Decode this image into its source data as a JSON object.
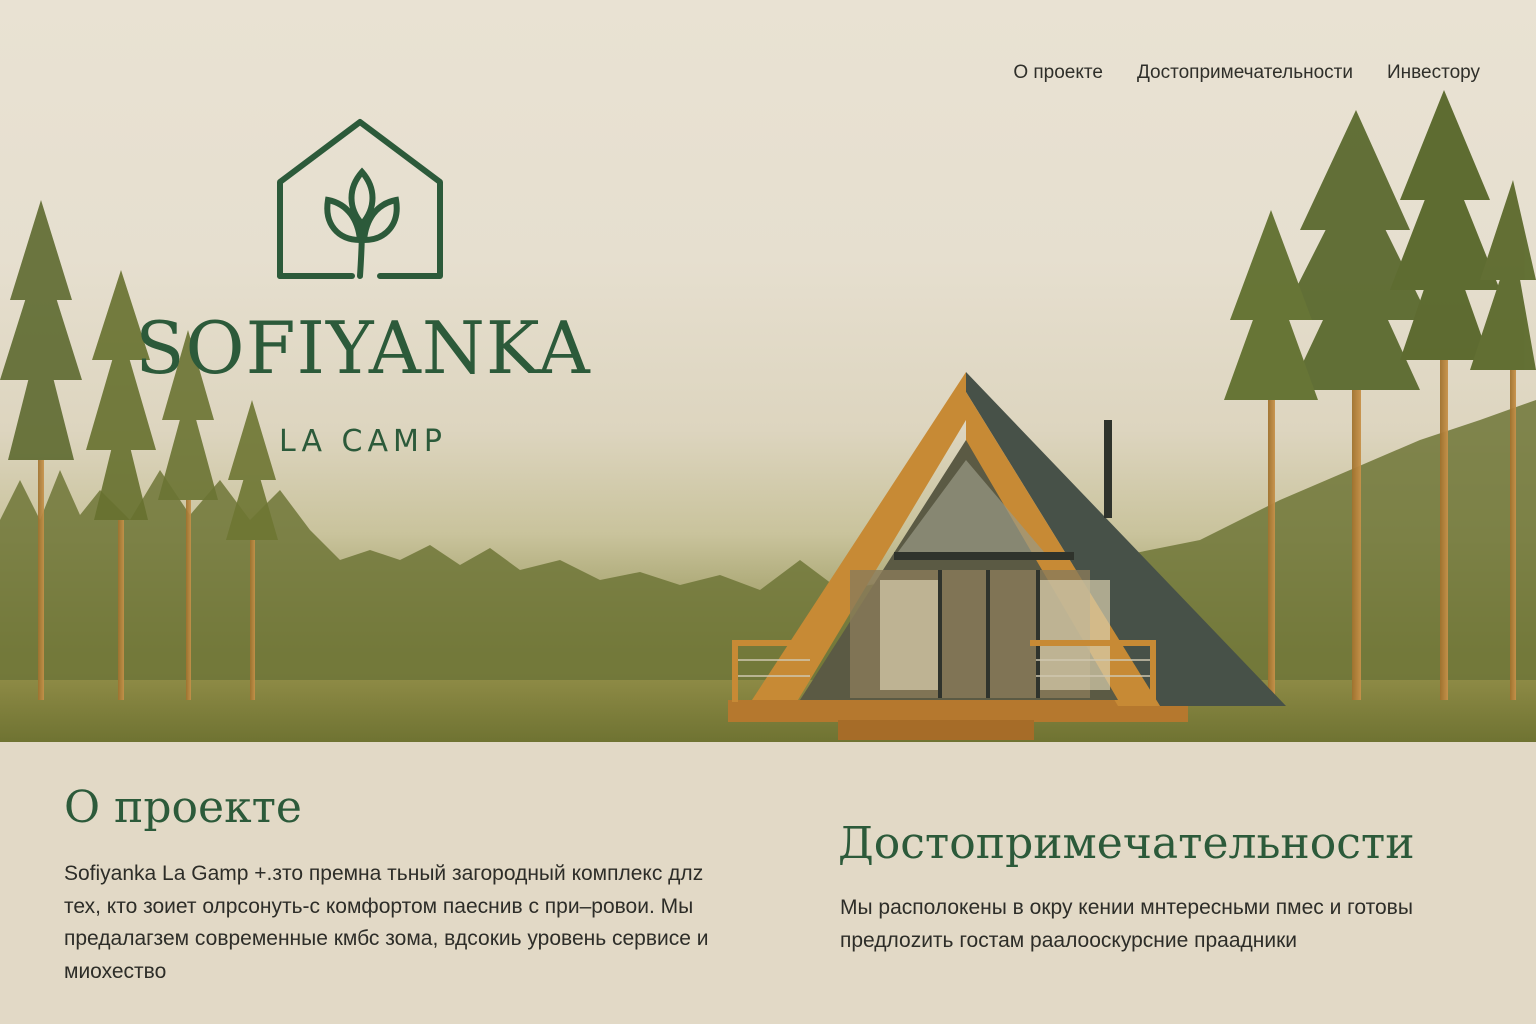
{
  "nav": {
    "items": [
      {
        "label": "О проекте"
      },
      {
        "label": "Достопримечательности"
      },
      {
        "label": "Инвестору"
      }
    ]
  },
  "brand": {
    "name": "SOFIYANKA",
    "subtitle": "LA CAMP",
    "icon": "house-leaf-icon",
    "color": "#2c5a3a"
  },
  "about": {
    "title": "О проекте",
    "text": "Sofiyanka La Gamp +.зто премна тьный загородный комплекс длz тех, кто зоиет олрсонуть-с комфортом паеснив с при–ровои. Мы предалагзем современные кмбс зома, вдсокиь уровень сервисе и миохество"
  },
  "sights": {
    "title": "Достопримечательности",
    "text": "Мы располокены в окру кении мнтересньми пмес и готовы предлоzить гостам раалоoскурсние праадники"
  }
}
